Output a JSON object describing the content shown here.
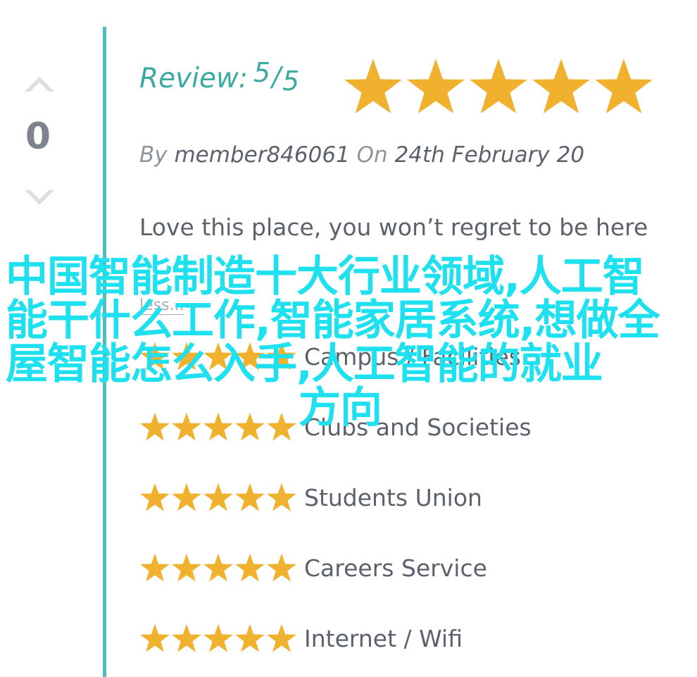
{
  "vote": {
    "count": "0",
    "up_icon": "chevron-up-icon",
    "down_icon": "chevron-down-icon"
  },
  "review": {
    "label": "Review:",
    "score": "5",
    "score_sep": "/",
    "score_max": "5",
    "rating": 5,
    "by_label": "By",
    "author": "member846061",
    "on_label": "On",
    "date": "24th February 20",
    "text": "Love this place, you won’t regret to be here",
    "less_link": "less..."
  },
  "categories": [
    {
      "label": "Campus / Facilities",
      "rating": 5
    },
    {
      "label": "Clubs and Societies",
      "rating": 5
    },
    {
      "label": "Students Union",
      "rating": 5
    },
    {
      "label": "Careers Service",
      "rating": 5
    },
    {
      "label": "Internet / Wifi",
      "rating": 5
    }
  ],
  "overlay": {
    "text": "中国智能制造十大行业领域,人工智能干什么工作,智能家居系统,想做全屋智能怎么入手,人工智能的就业",
    "text_last": "方向"
  },
  "colors": {
    "accent": "#4fbdb8",
    "review_teal": "#3caaa0",
    "star": "#f0b12f",
    "text": "#5b626b",
    "muted": "#8f959c",
    "overlay": "#1fe0ef"
  }
}
